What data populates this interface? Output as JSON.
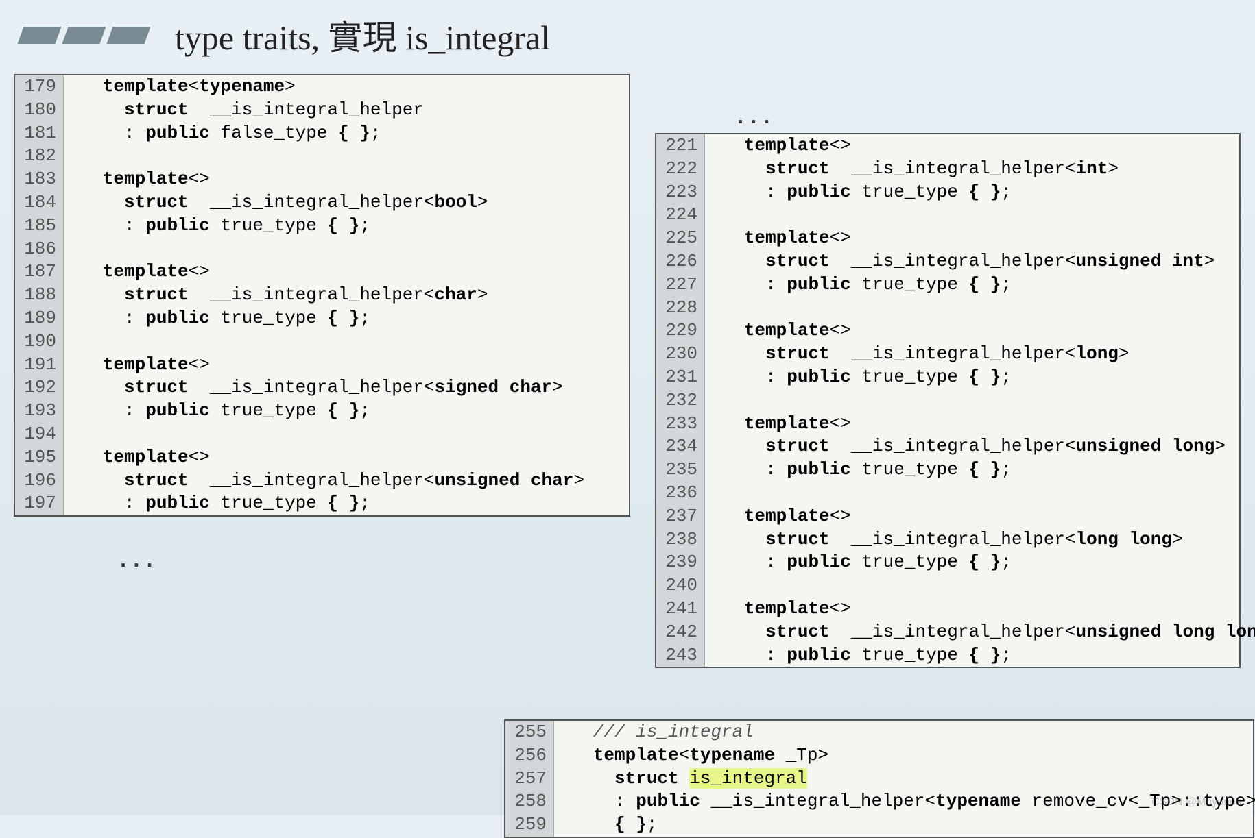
{
  "title": "type traits, 實現 is_integral",
  "ellipsis": "...",
  "watermark": "CSDN @Mhypnos",
  "box1": [
    {
      "n": "179",
      "pre": "   ",
      "t": [
        {
          "k": true,
          "s": "template"
        },
        {
          "k": false,
          "s": "<"
        },
        {
          "k": true,
          "s": "typename"
        },
        {
          "k": false,
          "s": ">"
        }
      ]
    },
    {
      "n": "180",
      "pre": "     ",
      "t": [
        {
          "k": true,
          "s": "struct"
        },
        {
          "k": false,
          "s": "  __is_integral_helper"
        }
      ]
    },
    {
      "n": "181",
      "pre": "     ",
      "t": [
        {
          "k": false,
          "s": ": "
        },
        {
          "k": true,
          "s": "public"
        },
        {
          "k": false,
          "s": " false_type "
        },
        {
          "k": true,
          "s": "{ }"
        },
        {
          "k": false,
          "s": ";"
        }
      ]
    },
    {
      "n": "182",
      "pre": "",
      "t": []
    },
    {
      "n": "183",
      "pre": "   ",
      "t": [
        {
          "k": true,
          "s": "template"
        },
        {
          "k": false,
          "s": "<>"
        }
      ]
    },
    {
      "n": "184",
      "pre": "     ",
      "t": [
        {
          "k": true,
          "s": "struct"
        },
        {
          "k": false,
          "s": "  __is_integral_helper<"
        },
        {
          "k": true,
          "s": "bool"
        },
        {
          "k": false,
          "s": ">"
        }
      ]
    },
    {
      "n": "185",
      "pre": "     ",
      "t": [
        {
          "k": false,
          "s": ": "
        },
        {
          "k": true,
          "s": "public"
        },
        {
          "k": false,
          "s": " true_type "
        },
        {
          "k": true,
          "s": "{ }"
        },
        {
          "k": false,
          "s": ";"
        }
      ]
    },
    {
      "n": "186",
      "pre": "",
      "t": []
    },
    {
      "n": "187",
      "pre": "   ",
      "t": [
        {
          "k": true,
          "s": "template"
        },
        {
          "k": false,
          "s": "<>"
        }
      ]
    },
    {
      "n": "188",
      "pre": "     ",
      "t": [
        {
          "k": true,
          "s": "struct"
        },
        {
          "k": false,
          "s": "  __is_integral_helper<"
        },
        {
          "k": true,
          "s": "char"
        },
        {
          "k": false,
          "s": ">"
        }
      ]
    },
    {
      "n": "189",
      "pre": "     ",
      "t": [
        {
          "k": false,
          "s": ": "
        },
        {
          "k": true,
          "s": "public"
        },
        {
          "k": false,
          "s": " true_type "
        },
        {
          "k": true,
          "s": "{ }"
        },
        {
          "k": false,
          "s": ";"
        }
      ]
    },
    {
      "n": "190",
      "pre": "",
      "t": []
    },
    {
      "n": "191",
      "pre": "   ",
      "t": [
        {
          "k": true,
          "s": "template"
        },
        {
          "k": false,
          "s": "<>"
        }
      ]
    },
    {
      "n": "192",
      "pre": "     ",
      "t": [
        {
          "k": true,
          "s": "struct"
        },
        {
          "k": false,
          "s": "  __is_integral_helper<"
        },
        {
          "k": true,
          "s": "signed char"
        },
        {
          "k": false,
          "s": ">"
        }
      ]
    },
    {
      "n": "193",
      "pre": "     ",
      "t": [
        {
          "k": false,
          "s": ": "
        },
        {
          "k": true,
          "s": "public"
        },
        {
          "k": false,
          "s": " true_type "
        },
        {
          "k": true,
          "s": "{ }"
        },
        {
          "k": false,
          "s": ";"
        }
      ]
    },
    {
      "n": "194",
      "pre": "",
      "t": []
    },
    {
      "n": "195",
      "pre": "   ",
      "t": [
        {
          "k": true,
          "s": "template"
        },
        {
          "k": false,
          "s": "<>"
        }
      ]
    },
    {
      "n": "196",
      "pre": "     ",
      "t": [
        {
          "k": true,
          "s": "struct"
        },
        {
          "k": false,
          "s": "  __is_integral_helper<"
        },
        {
          "k": true,
          "s": "unsigned char"
        },
        {
          "k": false,
          "s": ">"
        }
      ]
    },
    {
      "n": "197",
      "pre": "     ",
      "t": [
        {
          "k": false,
          "s": ": "
        },
        {
          "k": true,
          "s": "public"
        },
        {
          "k": false,
          "s": " true_type "
        },
        {
          "k": true,
          "s": "{ }"
        },
        {
          "k": false,
          "s": ";"
        }
      ]
    }
  ],
  "box2": [
    {
      "n": "221",
      "pre": "   ",
      "t": [
        {
          "k": true,
          "s": "template"
        },
        {
          "k": false,
          "s": "<>"
        }
      ]
    },
    {
      "n": "222",
      "pre": "     ",
      "t": [
        {
          "k": true,
          "s": "struct"
        },
        {
          "k": false,
          "s": "  __is_integral_helper<"
        },
        {
          "k": true,
          "s": "int"
        },
        {
          "k": false,
          "s": ">"
        }
      ]
    },
    {
      "n": "223",
      "pre": "     ",
      "t": [
        {
          "k": false,
          "s": ": "
        },
        {
          "k": true,
          "s": "public"
        },
        {
          "k": false,
          "s": " true_type "
        },
        {
          "k": true,
          "s": "{ }"
        },
        {
          "k": false,
          "s": ";"
        }
      ]
    },
    {
      "n": "224",
      "pre": "",
      "t": []
    },
    {
      "n": "225",
      "pre": "   ",
      "t": [
        {
          "k": true,
          "s": "template"
        },
        {
          "k": false,
          "s": "<>"
        }
      ]
    },
    {
      "n": "226",
      "pre": "     ",
      "t": [
        {
          "k": true,
          "s": "struct"
        },
        {
          "k": false,
          "s": "  __is_integral_helper<"
        },
        {
          "k": true,
          "s": "unsigned int"
        },
        {
          "k": false,
          "s": ">"
        }
      ]
    },
    {
      "n": "227",
      "pre": "     ",
      "t": [
        {
          "k": false,
          "s": ": "
        },
        {
          "k": true,
          "s": "public"
        },
        {
          "k": false,
          "s": " true_type "
        },
        {
          "k": true,
          "s": "{ }"
        },
        {
          "k": false,
          "s": ";"
        }
      ]
    },
    {
      "n": "228",
      "pre": "",
      "t": []
    },
    {
      "n": "229",
      "pre": "   ",
      "t": [
        {
          "k": true,
          "s": "template"
        },
        {
          "k": false,
          "s": "<>"
        }
      ]
    },
    {
      "n": "230",
      "pre": "     ",
      "t": [
        {
          "k": true,
          "s": "struct"
        },
        {
          "k": false,
          "s": "  __is_integral_helper<"
        },
        {
          "k": true,
          "s": "long"
        },
        {
          "k": false,
          "s": ">"
        }
      ]
    },
    {
      "n": "231",
      "pre": "     ",
      "t": [
        {
          "k": false,
          "s": ": "
        },
        {
          "k": true,
          "s": "public"
        },
        {
          "k": false,
          "s": " true_type "
        },
        {
          "k": true,
          "s": "{ }"
        },
        {
          "k": false,
          "s": ";"
        }
      ]
    },
    {
      "n": "232",
      "pre": "",
      "t": []
    },
    {
      "n": "233",
      "pre": "   ",
      "t": [
        {
          "k": true,
          "s": "template"
        },
        {
          "k": false,
          "s": "<>"
        }
      ]
    },
    {
      "n": "234",
      "pre": "     ",
      "t": [
        {
          "k": true,
          "s": "struct"
        },
        {
          "k": false,
          "s": "  __is_integral_helper<"
        },
        {
          "k": true,
          "s": "unsigned long"
        },
        {
          "k": false,
          "s": ">"
        }
      ]
    },
    {
      "n": "235",
      "pre": "     ",
      "t": [
        {
          "k": false,
          "s": ": "
        },
        {
          "k": true,
          "s": "public"
        },
        {
          "k": false,
          "s": " true_type "
        },
        {
          "k": true,
          "s": "{ }"
        },
        {
          "k": false,
          "s": ";"
        }
      ]
    },
    {
      "n": "236",
      "pre": "",
      "t": []
    },
    {
      "n": "237",
      "pre": "   ",
      "t": [
        {
          "k": true,
          "s": "template"
        },
        {
          "k": false,
          "s": "<>"
        }
      ]
    },
    {
      "n": "238",
      "pre": "     ",
      "t": [
        {
          "k": true,
          "s": "struct"
        },
        {
          "k": false,
          "s": "  __is_integral_helper<"
        },
        {
          "k": true,
          "s": "long long"
        },
        {
          "k": false,
          "s": ">"
        }
      ]
    },
    {
      "n": "239",
      "pre": "     ",
      "t": [
        {
          "k": false,
          "s": ": "
        },
        {
          "k": true,
          "s": "public"
        },
        {
          "k": false,
          "s": " true_type "
        },
        {
          "k": true,
          "s": "{ }"
        },
        {
          "k": false,
          "s": ";"
        }
      ]
    },
    {
      "n": "240",
      "pre": "",
      "t": []
    },
    {
      "n": "241",
      "pre": "   ",
      "t": [
        {
          "k": true,
          "s": "template"
        },
        {
          "k": false,
          "s": "<>"
        }
      ]
    },
    {
      "n": "242",
      "pre": "     ",
      "t": [
        {
          "k": true,
          "s": "struct"
        },
        {
          "k": false,
          "s": "  __is_integral_helper<"
        },
        {
          "k": true,
          "s": "unsigned long long"
        },
        {
          "k": false,
          "s": ">"
        }
      ]
    },
    {
      "n": "243",
      "pre": "     ",
      "t": [
        {
          "k": false,
          "s": ": "
        },
        {
          "k": true,
          "s": "public"
        },
        {
          "k": false,
          "s": " true_type "
        },
        {
          "k": true,
          "s": "{ }"
        },
        {
          "k": false,
          "s": ";"
        }
      ]
    }
  ],
  "box3": [
    {
      "n": "255",
      "pre": "   ",
      "t": [
        {
          "cm": true,
          "s": "/// is_integral"
        }
      ]
    },
    {
      "n": "256",
      "pre": "   ",
      "t": [
        {
          "k": true,
          "s": "template"
        },
        {
          "k": false,
          "s": "<"
        },
        {
          "k": true,
          "s": "typename"
        },
        {
          "k": false,
          "s": " _Tp>"
        }
      ]
    },
    {
      "n": "257",
      "pre": "     ",
      "t": [
        {
          "k": true,
          "s": "struct"
        },
        {
          "k": false,
          "s": " "
        },
        {
          "hl": true,
          "s": "is_integral"
        }
      ]
    },
    {
      "n": "258",
      "pre": "     ",
      "t": [
        {
          "k": false,
          "s": ": "
        },
        {
          "k": true,
          "s": "public"
        },
        {
          "k": false,
          "s": " __is_integral_helper<"
        },
        {
          "k": true,
          "s": "typename"
        },
        {
          "k": false,
          "s": " remove_cv<_Tp>::type>::type"
        }
      ]
    },
    {
      "n": "259",
      "pre": "     ",
      "t": [
        {
          "k": true,
          "s": "{ }"
        },
        {
          "k": false,
          "s": ";"
        }
      ]
    }
  ]
}
